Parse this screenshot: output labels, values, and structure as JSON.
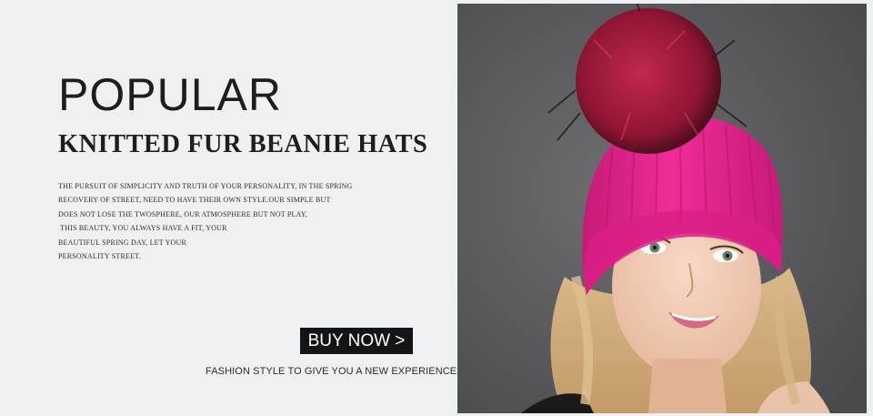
{
  "banner": {
    "headline": "POPULAR",
    "subheadline": "KNITTED FUR BEANIE HATS",
    "description_lines": [
      "THE PURSUIT OF SIMPLICITY AND TRUTH OF YOUR PERSONALITY, IN THE SPRING",
      "RECOVERY OF STREET, NEED TO HAVE THEIR OWN STYLE.OUR SIMPLE BUT",
      "DOES NOT LOSE THE TWOSPHERE, OUR ATMOSPHERE BUT NOT PLAY,",
      " THIS BEAUTY, YOU ALWAYS HAVE A FIT, YOUR",
      "BEAUTIFUL SPRING DAY, LET YOUR",
      "PERSONALITY STREET."
    ],
    "buy_button_label": "BUY NOW >",
    "tagline": "FASHION STYLE TO GIVE YOU A NEW EXPERIENCE"
  },
  "colors": {
    "background": "#eef1f4",
    "photo_backdrop": "#5b5b5e",
    "hat_pink": "#e8268f",
    "pompom_red": "#9e1a3a",
    "button": "#141414"
  }
}
